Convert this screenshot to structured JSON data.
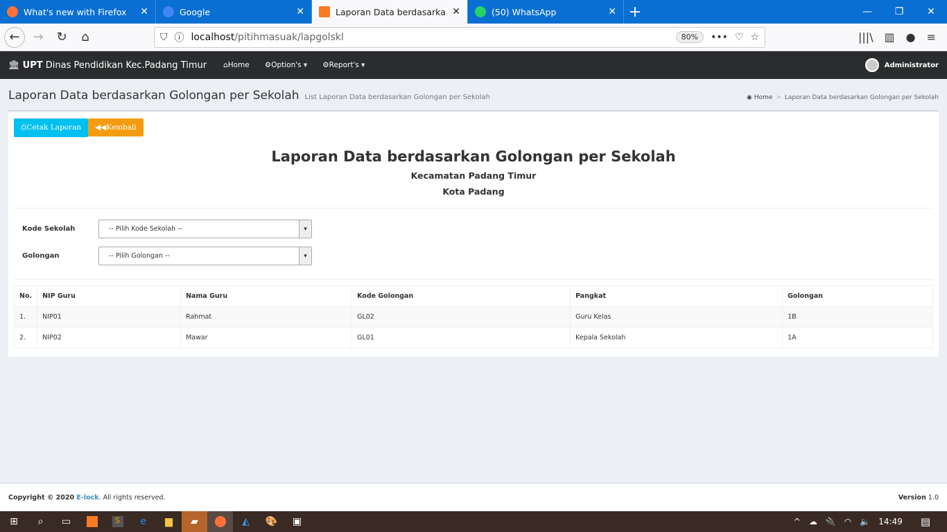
{
  "browser": {
    "tabs": [
      {
        "label": "What's new with Firefox",
        "color": "#ff7139"
      },
      {
        "label": "Google",
        "color": "#4285f4"
      },
      {
        "label": "Laporan Data berdasarkan Golongan per Sekolah",
        "color": "#fb7a24",
        "active": true
      },
      {
        "label": "(50) WhatsApp",
        "color": "#25d366"
      }
    ],
    "url_host": "localhost",
    "url_path": "/pitihmasuak/lapgolskl",
    "zoom": "80%"
  },
  "topbar": {
    "brand_bold": "UPT",
    "brand_rest": " Dinas Pendidikan Kec.Padang Timur",
    "menu": [
      "Home",
      "Option's ▾",
      "Report's ▾"
    ],
    "user": "Administrator"
  },
  "header": {
    "title": "Laporan Data berdasarkan Golongan per Sekolah",
    "subtitle": "List Laporan Data berdasarkan Golongan per Sekolah",
    "breadcrumb": [
      "Home",
      "Laporan Data berdasarkan Golongan per Sekolah"
    ]
  },
  "actions": {
    "print": "Cetak Laporan",
    "back": "Kembali"
  },
  "report": {
    "title": "Laporan Data berdasarkan Golongan per Sekolah",
    "line1": "Kecamatan Padang Timur",
    "line2": "Kota Padang"
  },
  "filters": [
    {
      "label": "Kode Sekolah",
      "value": "-- Pilih Kode Sekolah --"
    },
    {
      "label": "Golongan",
      "value": "-- Pilih Golongan --"
    }
  ],
  "table": {
    "headers": [
      "No.",
      "NIP Guru",
      "Nama Guru",
      "Kode Golongan",
      "Pangkat",
      "Golongan"
    ],
    "rows": [
      [
        "1.",
        "NIP01",
        "Rahmat",
        "GL02",
        "Guru Kelas",
        "1B"
      ],
      [
        "2.",
        "NIP02",
        "Mawar",
        "GL01",
        "Kepala Sekolah",
        "1A"
      ]
    ]
  },
  "footer": {
    "copy": "Copyright © 2020 ",
    "brand": "E-lock",
    "rest": ". All rights reserved.",
    "version_label": "Version",
    "version": " 1.0"
  },
  "taskbar": {
    "time": "14:49"
  }
}
